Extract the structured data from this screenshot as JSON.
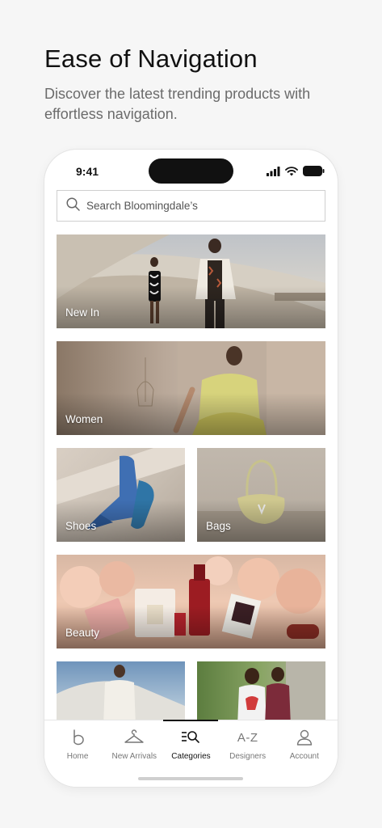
{
  "intro": {
    "title": "Ease of Navigation",
    "subtitle": "Discover the latest trending products with effortless navigation."
  },
  "status_bar": {
    "time": "9:41",
    "icons": [
      "signal-icon",
      "wifi-icon",
      "battery-icon"
    ]
  },
  "search": {
    "placeholder": "Search Bloomingdale’s",
    "icon": "search-icon"
  },
  "categories": [
    {
      "label": "New In"
    },
    {
      "label": "Women"
    },
    {
      "label": "Shoes"
    },
    {
      "label": "Bags"
    },
    {
      "label": "Beauty"
    },
    {
      "label": ""
    },
    {
      "label": ""
    }
  ],
  "tabbar": {
    "tabs": [
      {
        "label": "Home",
        "icon": "bloomingdales-b-icon",
        "active": false
      },
      {
        "label": "New Arrivals",
        "icon": "hanger-icon",
        "active": false
      },
      {
        "label": "Categories",
        "icon": "categories-search-icon",
        "active": true
      },
      {
        "label": "Designers",
        "icon": "a-z-icon",
        "icon_text": "A-Z",
        "active": false
      },
      {
        "label": "Account",
        "icon": "person-icon",
        "active": false
      }
    ]
  },
  "colors": {
    "background": "#f6f6f6",
    "text_primary": "#111111",
    "text_secondary": "#6b6b6b",
    "tab_inactive": "#777777"
  }
}
